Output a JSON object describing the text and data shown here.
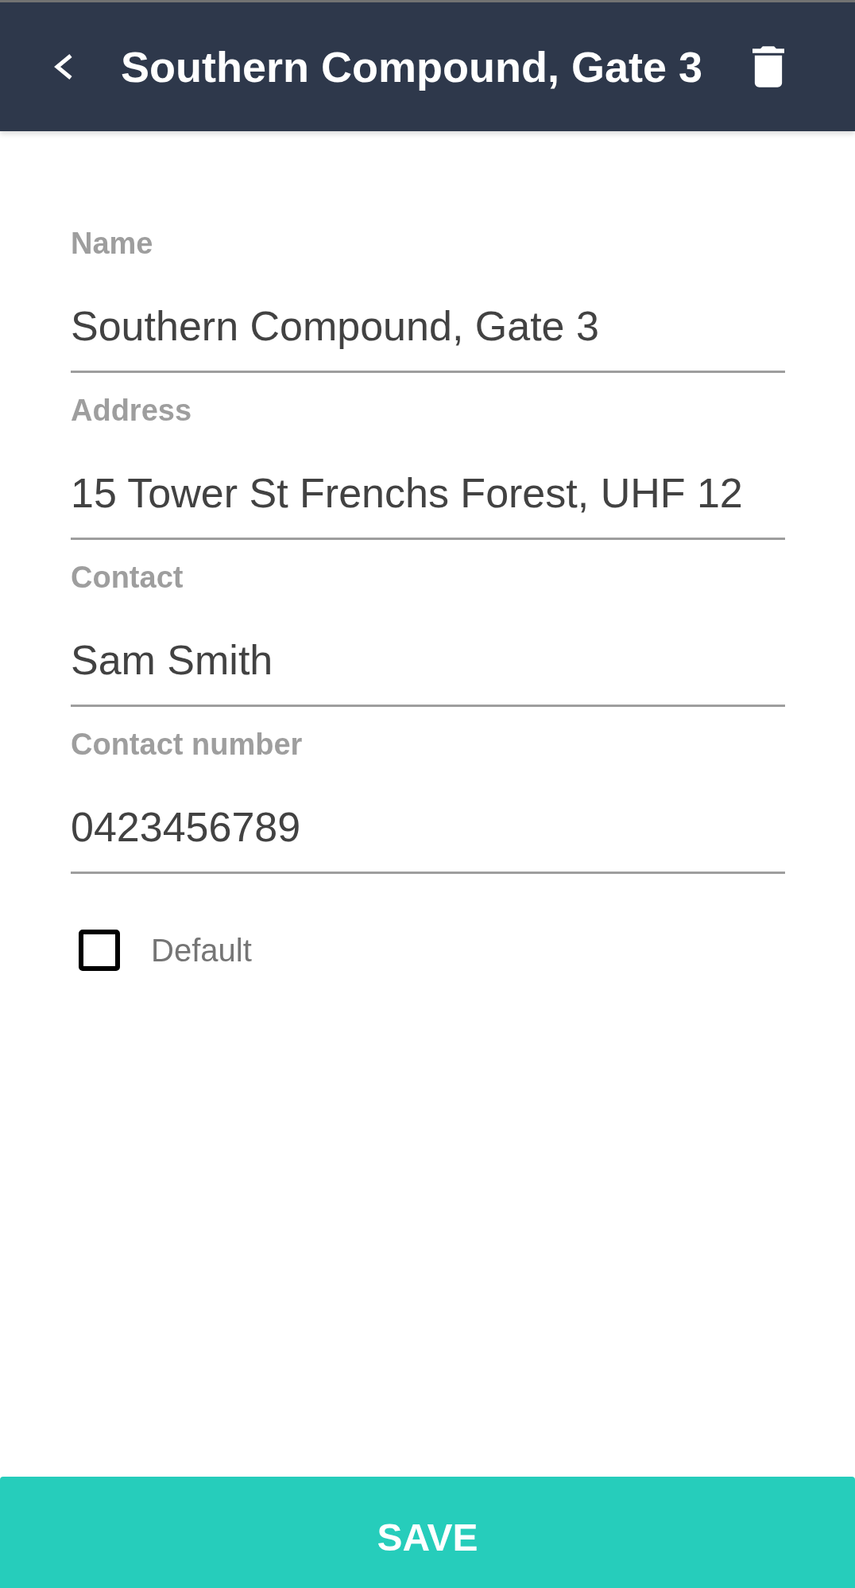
{
  "header": {
    "title": "Southern Compound, Gate 3"
  },
  "fields": [
    {
      "label": "Name",
      "value": "Southern Compound, Gate 3"
    },
    {
      "label": "Address",
      "value": "15 Tower St Frenchs Forest, UHF 12"
    },
    {
      "label": "Contact",
      "value": "Sam Smith"
    },
    {
      "label": "Contact number",
      "value": "0423456789"
    }
  ],
  "default_option": {
    "label": "Default",
    "checked": false
  },
  "save_button": {
    "label": "SAVE"
  }
}
